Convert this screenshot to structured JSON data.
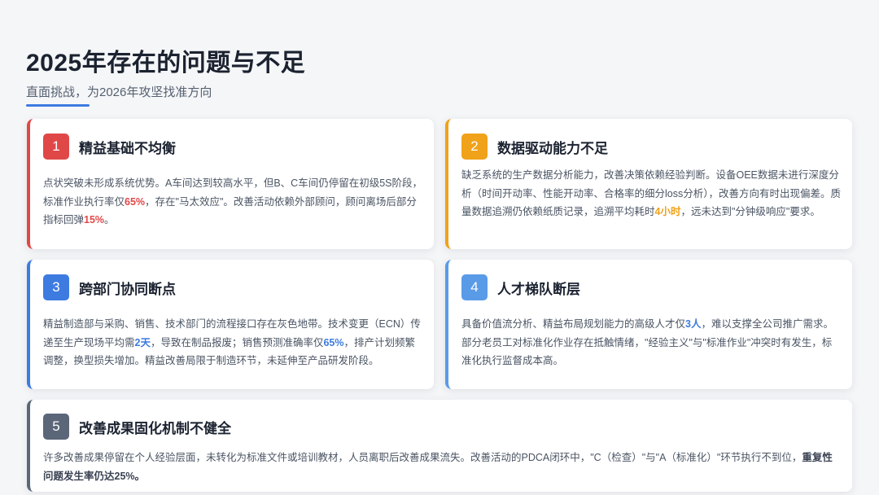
{
  "header": {
    "title": "2025年存在的问题与不足",
    "subtitle": "直面挑战，为2026年攻坚找准方向"
  },
  "colors": {
    "card1": "#e04848",
    "card2": "#f0a21a",
    "card3": "#3d7be0",
    "card4": "#5a9be8",
    "card5": "#5b6678"
  },
  "cards": [
    {
      "number": "1",
      "title": "精益基础不均衡",
      "body": {
        "p1": "点状突破未形成系统优势。A车间达到较高水平，但B、C车间仍停留在初级5S阶段，标准作业执行率仅",
        "h1": "65%",
        "p2": "，存在\"马太效应\"。改善活动依赖外部顾问，顾问离场后部分指标回弹",
        "h2": "15%",
        "p3": "。"
      }
    },
    {
      "number": "2",
      "title": "数据驱动能力不足",
      "body": {
        "p1": "缺乏系统的生产数据分析能力，改善决策依赖经验判断。设备OEE数据未进行深度分析（时间开动率、性能开动率、合格率的细分loss分析），改善方向有时出现偏差。质量数据追溯仍依赖纸质记录，追溯平均耗时",
        "h1": "4小时",
        "p2": "，远未达到\"分钟级响应\"要求。"
      }
    },
    {
      "number": "3",
      "title": "跨部门协同断点",
      "body": {
        "p1": "精益制造部与采购、销售、技术部门的流程接口存在灰色地带。技术变更（ECN）传递至生产现场平均需",
        "h1": "2天",
        "p2": "，导致在制品报废；销售预测准确率仅",
        "h2": "65%",
        "p3": "，排产计划频繁调整，换型损失增加。精益改善局限于制造环节，未延伸至产品研发阶段。"
      }
    },
    {
      "number": "4",
      "title": "人才梯队断层",
      "body": {
        "p1": "具备价值流分析、精益布局规划能力的高级人才仅",
        "h1": "3人",
        "p2": "，难以支撑全公司推广需求。部分老员工对标准化作业存在抵触情绪，\"经验主义\"与\"标准作业\"冲突时有发生，标准化执行监督成本高。"
      }
    },
    {
      "number": "5",
      "title": "改善成果固化机制不健全",
      "body": {
        "p1": "许多改善成果停留在个人经验层面，未转化为标准文件或培训教材，人员离职后改善成果流失。改善活动的PDCA闭环中，\"C（检查）\"与\"A（标准化）\"环节执行不到位，",
        "h1": "重复性问题发生率仍达25%。"
      }
    }
  ]
}
